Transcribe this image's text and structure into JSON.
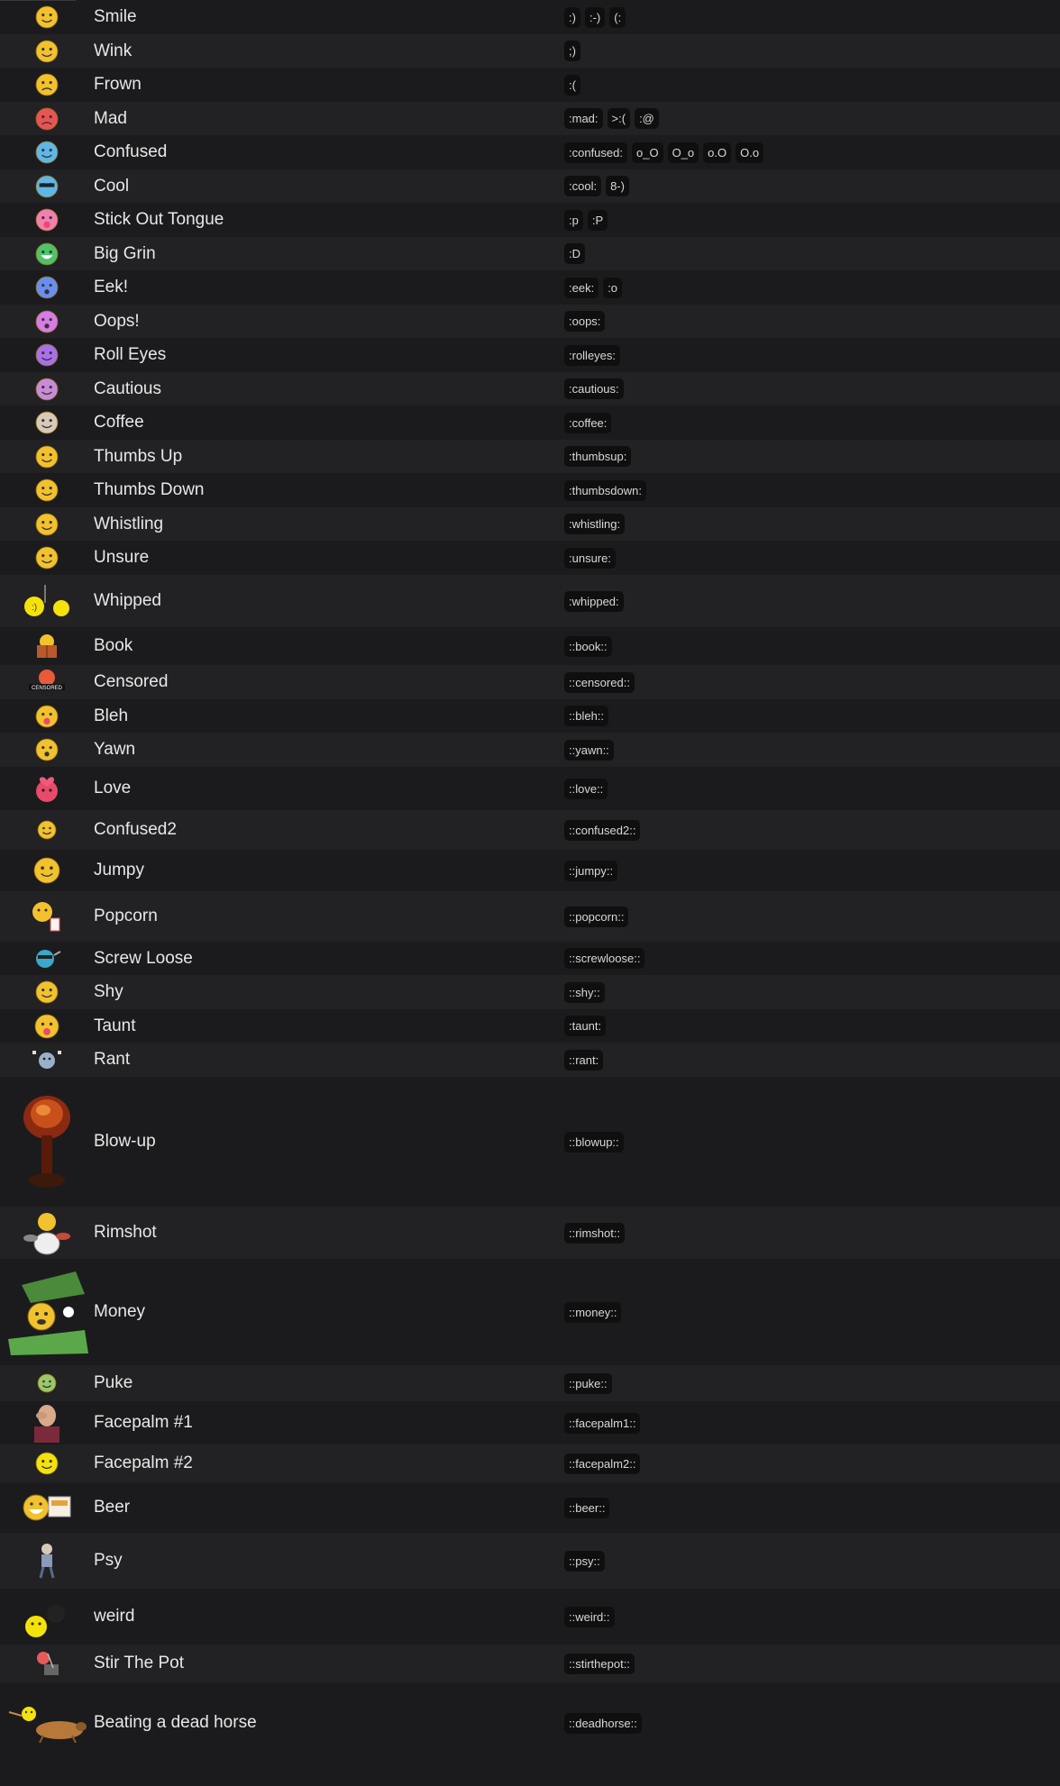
{
  "smilies": [
    {
      "name": "Smile",
      "codes": [
        ":)",
        ":-)",
        "(:"
      ],
      "icon": "smile-icon",
      "color": "#f2c12e"
    },
    {
      "name": "Wink",
      "codes": [
        ";)"
      ],
      "icon": "wink-icon",
      "color": "#f2c12e"
    },
    {
      "name": "Frown",
      "codes": [
        ":("
      ],
      "icon": "frown-icon",
      "color": "#f2c12e"
    },
    {
      "name": "Mad",
      "codes": [
        ":mad:",
        ">:(",
        ":@"
      ],
      "icon": "mad-icon",
      "color": "#e85454"
    },
    {
      "name": "Confused",
      "codes": [
        ":confused:",
        "o_O",
        "O_o",
        "o.O",
        "O.o"
      ],
      "icon": "confused-icon",
      "color": "#5fb7e8"
    },
    {
      "name": "Cool",
      "codes": [
        ":cool:",
        "8-)"
      ],
      "icon": "cool-icon",
      "color": "#5fb7e8"
    },
    {
      "name": "Stick Out Tongue",
      "codes": [
        ":p",
        ":P"
      ],
      "icon": "tongue-icon",
      "color": "#f27fb0"
    },
    {
      "name": "Big Grin",
      "codes": [
        ":D"
      ],
      "icon": "big-grin-icon",
      "color": "#4fc36a"
    },
    {
      "name": "Eek!",
      "codes": [
        ":eek:",
        ":o"
      ],
      "icon": "eek-icon",
      "color": "#6a8ef0"
    },
    {
      "name": "Oops!",
      "codes": [
        ":oops:"
      ],
      "icon": "oops-icon",
      "color": "#d77be8"
    },
    {
      "name": "Roll Eyes",
      "codes": [
        ":rolleyes:"
      ],
      "icon": "roll-eyes-icon",
      "color": "#a970e8"
    },
    {
      "name": "Cautious",
      "codes": [
        ":cautious:"
      ],
      "icon": "cautious-icon",
      "color": "#c98bd8"
    },
    {
      "name": "Coffee",
      "codes": [
        ":coffee:"
      ],
      "icon": "coffee-icon",
      "color": "#d8c9b8"
    },
    {
      "name": "Thumbs Up",
      "codes": [
        ":thumbsup:"
      ],
      "icon": "thumbs-up-icon",
      "color": "#f2c12e"
    },
    {
      "name": "Thumbs Down",
      "codes": [
        ":thumbsdown:"
      ],
      "icon": "thumbs-down-icon",
      "color": "#f2c12e"
    },
    {
      "name": "Whistling",
      "codes": [
        ":whistling:"
      ],
      "icon": "whistling-icon",
      "color": "#f2c12e"
    },
    {
      "name": "Unsure",
      "codes": [
        ":unsure:"
      ],
      "icon": "unsure-icon",
      "color": "#f2c12e"
    },
    {
      "name": "Whipped",
      "codes": [
        ":whipped:"
      ],
      "icon": "whipped-icon",
      "color": "#f5e20a"
    },
    {
      "name": "Book",
      "codes": [
        "::book::"
      ],
      "icon": "book-icon",
      "color": "#e8a13a"
    },
    {
      "name": "Censored",
      "codes": [
        "::censored::"
      ],
      "icon": "censored-icon",
      "color": "#e85a3a"
    },
    {
      "name": "Bleh",
      "codes": [
        "::bleh::"
      ],
      "icon": "bleh-icon",
      "color": "#f2c12e"
    },
    {
      "name": "Yawn",
      "codes": [
        "::yawn::"
      ],
      "icon": "yawn-icon",
      "color": "#f2c12e"
    },
    {
      "name": "Love",
      "codes": [
        "::love::"
      ],
      "icon": "love-icon",
      "color": "#e84a6a"
    },
    {
      "name": "Confused2",
      "codes": [
        "::confused2::"
      ],
      "icon": "confused2-icon",
      "color": "#f2c12e"
    },
    {
      "name": "Jumpy",
      "codes": [
        "::jumpy::"
      ],
      "icon": "jumpy-icon",
      "color": "#f2c12e"
    },
    {
      "name": "Popcorn",
      "codes": [
        "::popcorn::"
      ],
      "icon": "popcorn-icon",
      "color": "#f2c12e"
    },
    {
      "name": "Screw Loose",
      "codes": [
        "::screwloose::"
      ],
      "icon": "screw-loose-icon",
      "color": "#3aa8c8"
    },
    {
      "name": "Shy",
      "codes": [
        "::shy::"
      ],
      "icon": "shy-icon",
      "color": "#f2c12e"
    },
    {
      "name": "Taunt",
      "codes": [
        ":taunt:"
      ],
      "icon": "taunt-icon",
      "color": "#f2c12e"
    },
    {
      "name": "Rant",
      "codes": [
        "::rant:"
      ],
      "icon": "rant-icon",
      "color": "#9ab0c8"
    },
    {
      "name": "Blow-up",
      "codes": [
        "::blowup::"
      ],
      "icon": "blow-up-icon",
      "color": "#b8401a"
    },
    {
      "name": "Rimshot",
      "codes": [
        "::rimshot::"
      ],
      "icon": "rimshot-icon",
      "color": "#f2c12e"
    },
    {
      "name": "Money",
      "codes": [
        "::money::"
      ],
      "icon": "money-icon",
      "color": "#6ab84a"
    },
    {
      "name": "Puke",
      "codes": [
        "::puke::"
      ],
      "icon": "puke-icon",
      "color": "#9ac86a"
    },
    {
      "name": "Facepalm #1",
      "codes": [
        "::facepalm1::"
      ],
      "icon": "facepalm1-icon",
      "color": "#c89a7a"
    },
    {
      "name": "Facepalm #2",
      "codes": [
        "::facepalm2::"
      ],
      "icon": "facepalm2-icon",
      "color": "#f5e20a"
    },
    {
      "name": "Beer",
      "codes": [
        "::beer::"
      ],
      "icon": "beer-icon",
      "color": "#f2c12e"
    },
    {
      "name": "Psy",
      "codes": [
        "::psy::"
      ],
      "icon": "psy-icon",
      "color": "#8a9ab8"
    },
    {
      "name": "weird",
      "codes": [
        "::weird::"
      ],
      "icon": "weird-icon",
      "color": "#f5e20a"
    },
    {
      "name": "Stir The Pot",
      "codes": [
        "::stirthepot::"
      ],
      "icon": "stir-the-pot-icon",
      "color": "#e85a5a"
    },
    {
      "name": "Beating a dead horse",
      "codes": [
        "::deadhorse::"
      ],
      "icon": "dead-horse-icon",
      "color": "#c8884a"
    }
  ]
}
